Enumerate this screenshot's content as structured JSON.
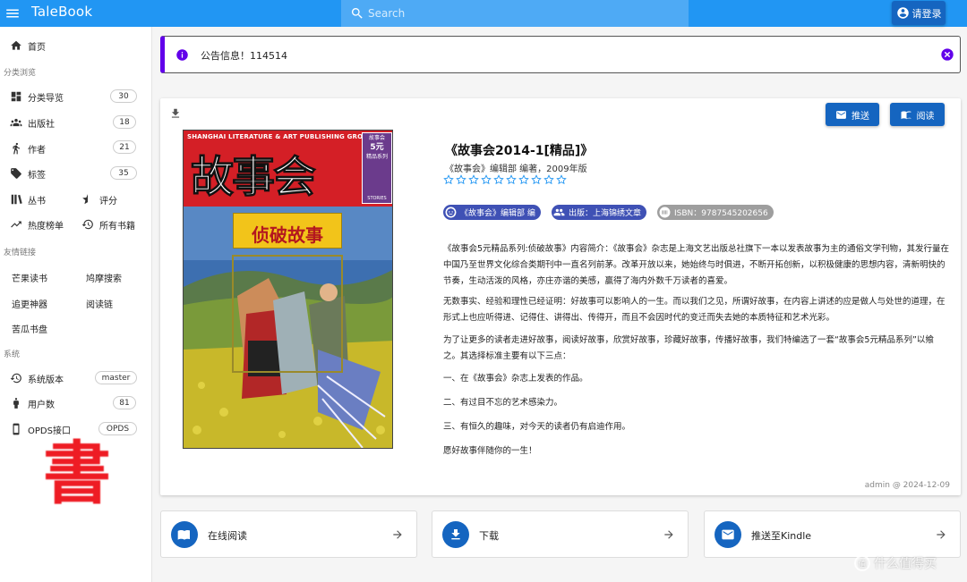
{
  "app": {
    "title": "TaleBook"
  },
  "search": {
    "placeholder": "Search"
  },
  "header": {
    "login_label": "请登录"
  },
  "sidebar": {
    "home": "首页",
    "section_browse": "分类浏览",
    "categories": {
      "label": "分类导览",
      "count": "30"
    },
    "publishers": {
      "label": "出版社",
      "count": "18"
    },
    "authors": {
      "label": "作者",
      "count": "21"
    },
    "tags": {
      "label": "标签",
      "count": "35"
    },
    "series": "丛书",
    "rating": "评分",
    "hot": "热度榜单",
    "all_books": "所有书籍",
    "section_links": "友情链接",
    "links": [
      "芒果读书",
      "鸠摩搜索",
      "追更神器",
      "阅读链",
      "苦瓜书盘"
    ],
    "section_system": "系统",
    "version": {
      "label": "系统版本",
      "value": "master"
    },
    "users": {
      "label": "用户数",
      "value": "81"
    },
    "opds": {
      "label": "OPDS接口",
      "value": "OPDS"
    },
    "brand_char": "書"
  },
  "notice": {
    "text": "公告信息！114514"
  },
  "book": {
    "buttons": {
      "push": "推送",
      "read": "阅读"
    },
    "cover": {
      "publisher_line": "SHANGHAI LITERATURE & ART PUBLISHING GROUP",
      "title": "故事会",
      "subtitle": "侦破故事",
      "box_line1": "故事会",
      "box_line2": "5元",
      "box_line3": "精品系列",
      "box_stories": "STORIES"
    },
    "title": "《故事会2014-1[精品]》",
    "meta": "《故事会》编辑部 编著，2009年版",
    "rating": 0,
    "chips": {
      "author": "《故事会》编辑部 编",
      "publisher": "出版：上海锦绣文章",
      "isbn": "ISBN：9787545202656"
    },
    "paragraphs": [
      "《故事会5元精品系列:侦破故事》内容简介：《故事会》杂志是上海文艺出版总社旗下一本以发表故事为主的通俗文学刊物，其发行量在中国乃至世界文化综合类期刊中一直名列前茅。改革开放以来，她始终与时俱进，不断开拓创新，以积极健康的思想内容，清新明快的节奏，生动活泼的风格，亦庄亦谐的美感，赢得了海内外数千万读者的喜爱。",
      "无数事实、经验和理性已经证明：好故事可以影响人的一生。而以我们之见，所谓好故事，在内容上讲述的应是做人与处世的道理，在形式上也应听得进、记得住、讲得出、传得开，而且不会因时代的变迁而失去她的本质特征和艺术光彩。",
      "为了让更多的读者走进好故事，阅读好故事，欣赏好故事，珍藏好故事，传播好故事，我们特编选了一套“故事会5元精品系列”以飨之。其选择标准主要有以下三点：",
      "一、在《故事会》杂志上发表的作品。",
      "二、有过目不忘的艺术感染力。",
      "三、有恒久的趣味，对今天的读者仍有启迪作用。",
      "愿好故事伴随你的一生！"
    ],
    "footer": "admin @ 2024-12-09"
  },
  "actions": {
    "read_online": "在线阅读",
    "download": "下载",
    "kindle": "推送至Kindle"
  },
  "watermark": {
    "badge": "值",
    "text": "什么值得买"
  },
  "colors": {
    "topbar": "#2196f3",
    "primary": "#1565c0",
    "notice_accent": "#6200ea",
    "chip_author": "#3f51b5",
    "chip_isbn": "#9e9e9e"
  }
}
